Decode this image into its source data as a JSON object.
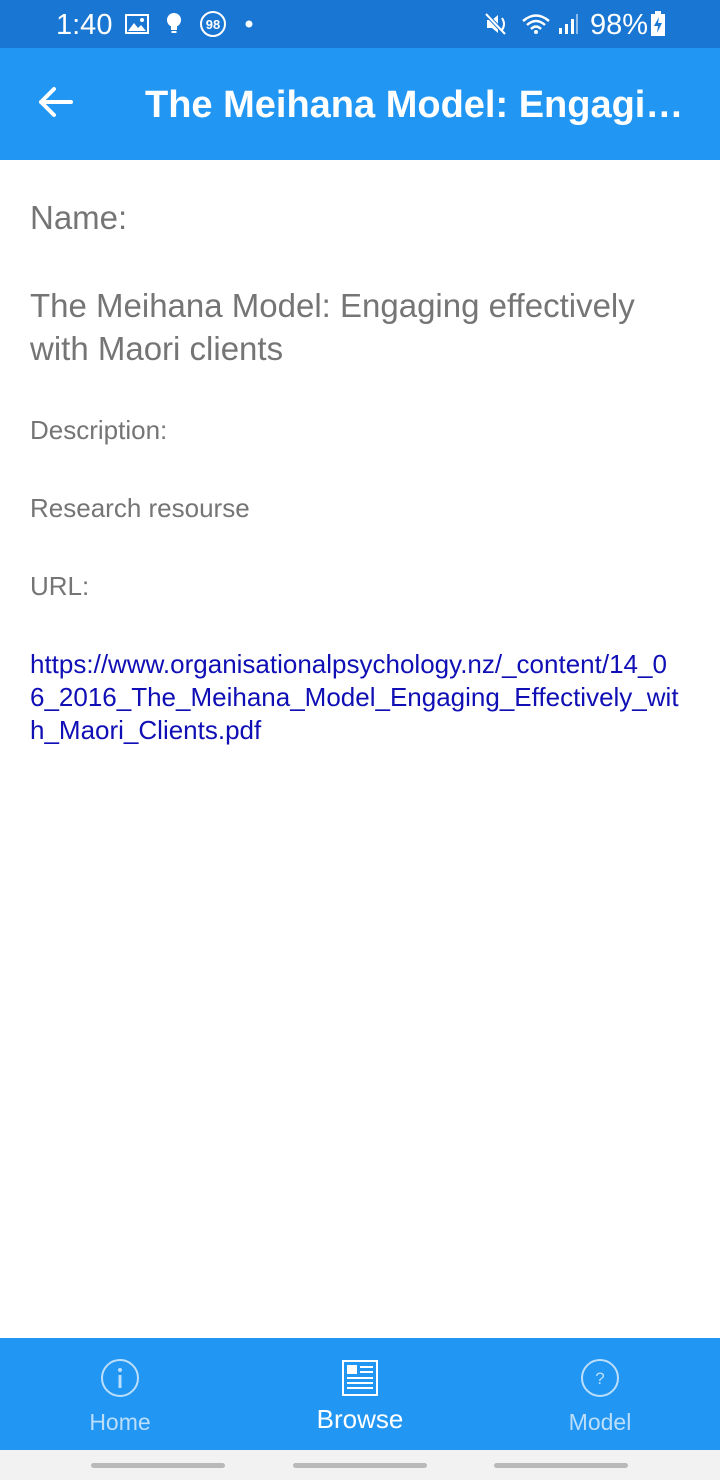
{
  "status_bar": {
    "time": "1:40",
    "badge": "98",
    "battery": "98%",
    "icons": [
      "gallery-icon",
      "bulb-icon",
      "badge-icon",
      "dot-icon",
      "mute-icon",
      "wifi-icon",
      "signal-icon",
      "battery-charging-icon"
    ]
  },
  "app_bar": {
    "title": "The Meihana Model: Engaging effectively with Maori clients",
    "back_icon": "back-arrow-icon"
  },
  "content": {
    "name_label": "Name:",
    "name_value": "The Meihana Model: Engaging effectively with Maori clients",
    "description_label": "Description:",
    "description_value": "Research resourse",
    "url_label": "URL:",
    "url_value": "https://www.organisationalpsychology.nz/_content/14_06_2016_The_Meihana_Model_Engaging_Effectively_with_Maori_Clients.pdf"
  },
  "bottom_nav": {
    "items": [
      {
        "label": "Home",
        "icon": "info-icon",
        "active": false
      },
      {
        "label": "Browse",
        "icon": "newspaper-icon",
        "active": true
      },
      {
        "label": "Model",
        "icon": "help-icon",
        "active": false
      }
    ]
  },
  "colors": {
    "status_bar": "#1976d2",
    "primary": "#2196f3",
    "link": "#0f0fb5",
    "text_secondary": "#757575",
    "nav_inactive": "#bbdefb"
  }
}
